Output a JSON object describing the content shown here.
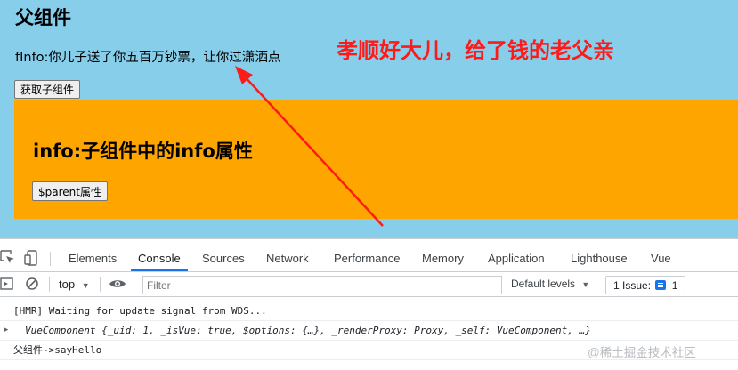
{
  "app": {
    "parent_title": "父组件",
    "parent_info": "fInfo:你儿子送了你五百万钞票，让你过潇洒点",
    "get_child_button": "获取子组件",
    "annotation": "孝顺好大儿，给了钱的老父亲",
    "child_title": "info:子组件中的info属性",
    "parent_button": "$parent属性"
  },
  "devtools": {
    "tabs": [
      "Elements",
      "Console",
      "Sources",
      "Network",
      "Performance",
      "Memory",
      "Application",
      "Lighthouse",
      "Vue"
    ],
    "active_tab": "Console",
    "context": "top",
    "filter_placeholder": "Filter",
    "levels_label": "Default levels",
    "issues_prefix": "1 Issue:",
    "issues_count": "1",
    "console_lines": [
      "[HMR] Waiting for update signal from WDS...",
      "VueComponent {_uid: 1, _isVue: true, $options: {…}, _renderProxy: Proxy, _self: VueComponent, …}",
      "父组件->sayHello"
    ]
  },
  "watermark": "@稀土掘金技术社区",
  "colors": {
    "app_background": "#87ceeb",
    "child_background": "#ffa500",
    "annotation": "#ff1a1a",
    "active_tab_underline": "#1a73e8"
  },
  "icons": [
    "inspect-element-icon",
    "device-toolbar-icon",
    "sidebar-toggle-icon",
    "clear-console-icon",
    "eye-icon",
    "dropdown-caret-icon",
    "issue-icon"
  ]
}
